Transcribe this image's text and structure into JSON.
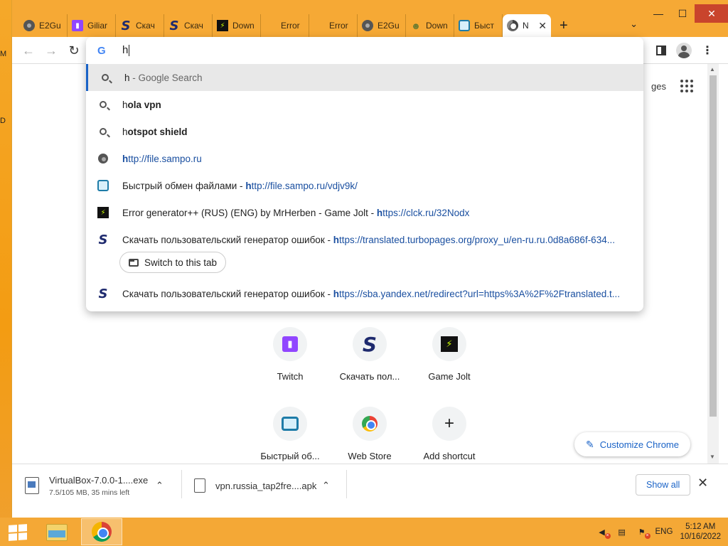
{
  "desktop": {
    "edge_letters": [
      "M",
      "D"
    ]
  },
  "window_controls": {
    "minimize": "—",
    "maximize": "☐",
    "close": "✕"
  },
  "tabs": [
    {
      "label": "E2Gu",
      "icon": "globe-icon"
    },
    {
      "label": "Giliar",
      "icon": "twitch-icon"
    },
    {
      "label": "Скач",
      "icon": "s-logo-icon"
    },
    {
      "label": "Скач",
      "icon": "s-logo-icon"
    },
    {
      "label": "Down",
      "icon": "gamejolt-icon"
    },
    {
      "label": "Error",
      "icon": "windows-logo-icon"
    },
    {
      "label": "Error",
      "icon": "windows-logo-icon"
    },
    {
      "label": "E2Gu",
      "icon": "globe-icon"
    },
    {
      "label": "Down",
      "icon": "download-site-icon"
    },
    {
      "label": "Быст",
      "icon": "file-share-icon"
    },
    {
      "label": "N",
      "icon": "chrome-icon",
      "active": true
    }
  ],
  "new_tab_symbol": "+",
  "tab_search_symbol": "⌄",
  "toolbar": {
    "back": "←",
    "forward": "→",
    "reload": "↻",
    "menu": "⋮"
  },
  "omnibox": {
    "typed_text": "h",
    "google_logo": "G",
    "suggestions": [
      {
        "type": "search",
        "prefix": "h",
        "rest": " - Google Search",
        "selected": true
      },
      {
        "type": "search",
        "prefix": "h",
        "rest": "ola vpn"
      },
      {
        "type": "search",
        "prefix": "h",
        "rest": "otspot shield"
      },
      {
        "type": "url",
        "prefix": "h",
        "rest": "ttp://file.sampo.ru"
      },
      {
        "type": "page",
        "title": "Быстрый обмен файлами - ",
        "prefix": "h",
        "rest": "ttp://file.sampo.ru/vdjv9k/"
      },
      {
        "type": "page",
        "title": "Error generator++ (RUS) (ENG) by MrHerben - Game Jolt - ",
        "prefix": "h",
        "rest": "ttps://clck.ru/32Nodx"
      },
      {
        "type": "page",
        "title": "Скачать пользовательский генератор ошибок - ",
        "prefix": "h",
        "rest": "ttps://translated.turbopages.org/proxy_u/en-ru.ru.0d8a686f-634..."
      },
      {
        "type": "page",
        "title": "Скачать пользовательский генератор ошибок - ",
        "prefix": "h",
        "rest": "ttps://sba.yandex.net/redirect?url=https%3A%2F%2Ftranslated.t..."
      }
    ],
    "switch_tab_label": "Switch to this tab"
  },
  "page": {
    "pages_fragment": "ges",
    "shortcuts": [
      {
        "label": "Twitch"
      },
      {
        "label": "Скачать пол..."
      },
      {
        "label": "Game Jolt"
      },
      {
        "label": "Быстрый об..."
      },
      {
        "label": "Web Store"
      },
      {
        "label": "Add shortcut"
      }
    ],
    "customize_label": "Customize Chrome"
  },
  "downloads": {
    "items": [
      {
        "name": "VirtualBox-7.0.0-1....exe",
        "status": "7.5/105 MB, 35 mins left"
      },
      {
        "name": "vpn.russia_tap2fre....apk",
        "status": ""
      }
    ],
    "show_all": "Show all",
    "close": "✕"
  },
  "taskbar": {
    "language": "ENG",
    "time": "5:12 AM",
    "date": "10/16/2022"
  }
}
